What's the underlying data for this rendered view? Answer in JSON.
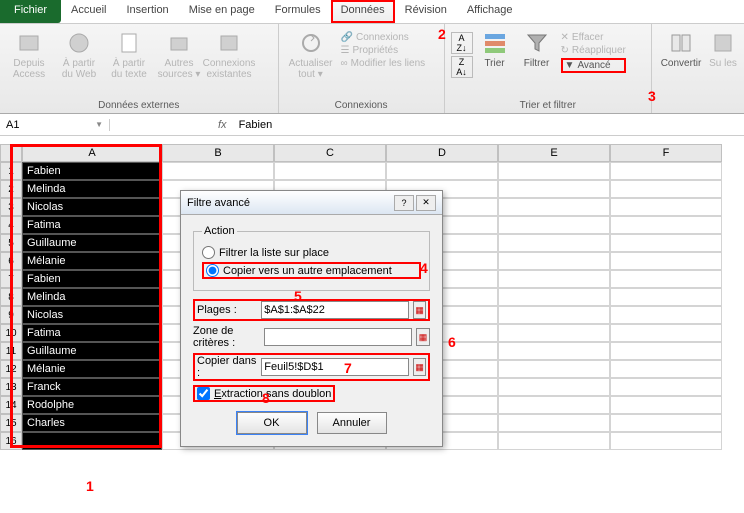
{
  "tabs": {
    "file": "Fichier",
    "home": "Accueil",
    "insert": "Insertion",
    "layout": "Mise en page",
    "formulas": "Formules",
    "data": "Données",
    "review": "Révision",
    "view": "Affichage"
  },
  "ribbon": {
    "ext": {
      "access": "Depuis Access",
      "web": "À partir du Web",
      "text": "À partir du texte",
      "other": "Autres sources ▾",
      "existing": "Connexions existantes",
      "group": "Données externes"
    },
    "conn": {
      "refresh": "Actualiser tout ▾",
      "connections": "Connexions",
      "properties": "Propriétés",
      "editlinks": "Modifier les liens",
      "group": "Connexions"
    },
    "sort": {
      "az": "A↓Z",
      "za": "Z↓A",
      "sort": "Trier",
      "filter": "Filtrer",
      "clear": "Effacer",
      "reapply": "Réappliquer",
      "advanced": "Avancé",
      "group": "Trier et filtrer"
    },
    "tools": {
      "convert": "Convertir",
      "remove": "Su les"
    }
  },
  "namebox": "A1",
  "fx_value": "Fabien",
  "cols": [
    "A",
    "B",
    "C",
    "D",
    "E",
    "F"
  ],
  "rows": [
    "Fabien",
    "Melinda",
    "Nicolas",
    "Fatima",
    "Guillaume",
    "Mélanie",
    "Fabien",
    "Melinda",
    "Nicolas",
    "Fatima",
    "Guillaume",
    "Mélanie",
    "Franck",
    "Rodolphe",
    "Charles",
    ""
  ],
  "dialog": {
    "title": "Filtre avancé",
    "legend": "Action",
    "opt_inplace": "Filtrer la liste sur place",
    "opt_copy": "Copier vers un autre emplacement",
    "lbl_range": "Plages :",
    "val_range": "$A$1:$A$22",
    "lbl_crit": "Zone de critères :",
    "val_crit": "",
    "lbl_copyto": "Copier dans :",
    "val_copyto": "Feuil5!$D$1",
    "chk_unique": "Extraction sans doublon",
    "ok": "OK",
    "cancel": "Annuler"
  },
  "annotations": {
    "a1": "1",
    "a2": "2",
    "a3": "3",
    "a4": "4",
    "a5": "5",
    "a6": "6",
    "a7": "7",
    "a8": "8"
  }
}
